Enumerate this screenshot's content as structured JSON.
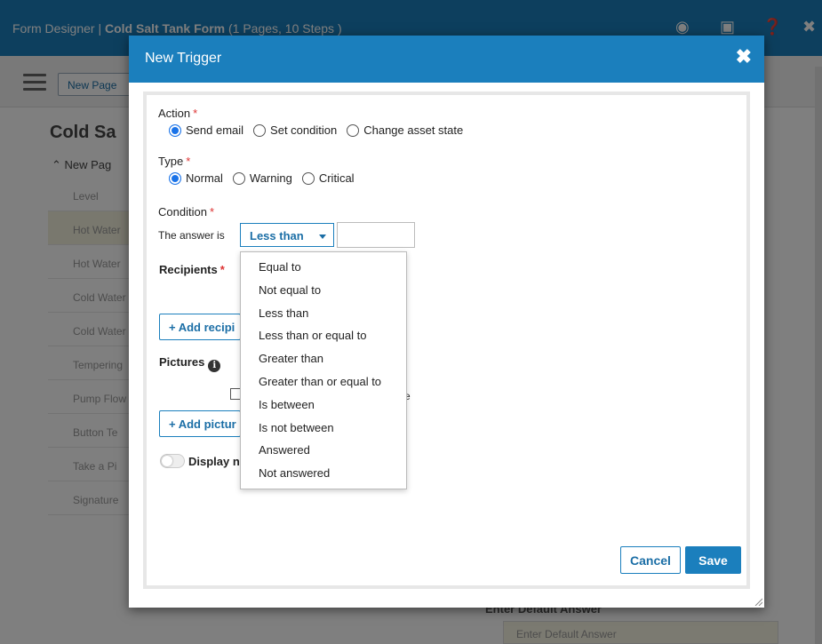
{
  "app": {
    "title_prefix": "Form Designer | ",
    "title_form": "Cold Salt Tank Form",
    "title_suffix": " (1 Pages, 10 Steps )",
    "new_page_button": "New Page",
    "sidebar_title": "Cold Sa",
    "sidebar_page": "New Pag",
    "sidebar_items": [
      "Level",
      "Hot Water",
      "Hot Water",
      "Cold Water",
      "Cold Water",
      "Tempering",
      "Pump Flow",
      "Button Te",
      "Take a Pi",
      "Signature"
    ],
    "default_answer_label": "Enter Default Answer",
    "default_answer_placeholder": "Enter Default Answer"
  },
  "modal": {
    "title": "New Trigger",
    "action": {
      "label": "Action",
      "options": [
        "Send email",
        "Set condition",
        "Change asset state"
      ],
      "selected": "Send email"
    },
    "type": {
      "label": "Type",
      "options": [
        "Normal",
        "Warning",
        "Critical"
      ],
      "selected": "Normal"
    },
    "condition": {
      "label": "Condition",
      "prefix": "The answer is",
      "selected": "Less than",
      "value": ""
    },
    "recipients": {
      "label": "Recipients",
      "add_button": "+ Add recipi"
    },
    "pictures": {
      "label": "Pictures",
      "checkbox_tail": "e",
      "add_button": "+ Add pictur"
    },
    "display_toggle_label": "Display n",
    "cancel_label": "Cancel",
    "save_label": "Save"
  },
  "dropdown": {
    "options": [
      "Equal to",
      "Not equal to",
      "Less than",
      "Less than or equal to",
      "Greater than",
      "Greater than or equal to",
      "Is between",
      "Is not between",
      "Answered",
      "Not answered"
    ]
  },
  "colors": {
    "brand_blue": "#1b7fbd",
    "required_red": "#dd3333",
    "overlay": "rgba(0,0,0,0.5)"
  }
}
